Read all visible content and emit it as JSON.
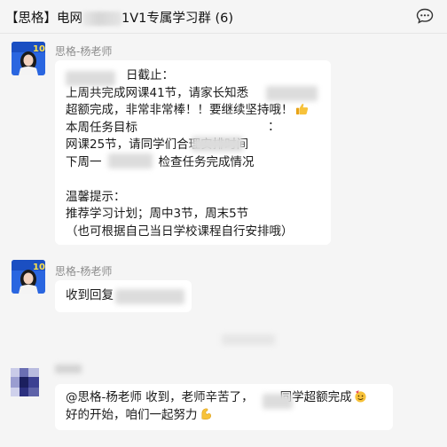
{
  "header": {
    "title_prefix": "【思格】电网",
    "title_suffix": "1V1专属学习群 (6)",
    "more_icon": "more-chat-icon"
  },
  "messages": [
    {
      "sender": "思格-杨老师",
      "avatar_badge": "10",
      "lines": [
        "日截止：",
        "上周共完成网课41节，请家长知悉",
        "超额完成，非常非常棒！！要继续坚持哦！",
        "本周任务目标",
        "网课25节，请同学们合理安排时间",
        "下周一",
        "",
        "温馨提示：",
        "推荐学习计划；周中3节，周末5节",
        "（也可根据自己当日学校课程自行安排哦）"
      ],
      "line_tail_colon": "：",
      "line_tail_check": "检查任务完成情况",
      "thumbs_emoji": "thumbs-up-icon"
    },
    {
      "sender": "思格-杨老师",
      "avatar_badge": "10",
      "text": "收到回复"
    },
    {
      "sender": "",
      "text_line1_a": "@思格-杨老师 收到，老师辛苦了，",
      "text_line1_b": "同学超额完成",
      "text_line2": "好的开始，咱们一起努力",
      "emoji_1": "party-face-icon",
      "emoji_2": "flexed-biceps-icon"
    }
  ],
  "colors": {
    "background": "#f5f5f5",
    "bubble": "#ffffff",
    "sender_name": "#8c8c8c",
    "avatar_blue": "#1e5bd8"
  }
}
